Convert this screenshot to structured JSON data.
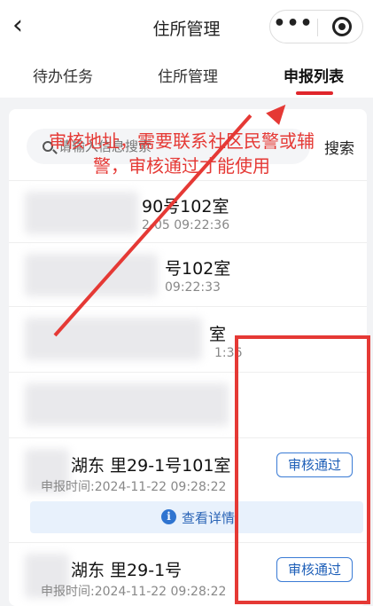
{
  "nav": {
    "back_icon": "‹",
    "title": "住所管理",
    "more_icon": "•••"
  },
  "tabs": [
    {
      "label": "待办任务"
    },
    {
      "label": "住所管理"
    },
    {
      "label": "申报列表"
    }
  ],
  "search": {
    "placeholder": "请输入信息搜索",
    "button_label": "搜索"
  },
  "rows": [
    {
      "address": "90号102室",
      "time": "2-05 09:22:36"
    },
    {
      "address": "号102室",
      "time": "09:22:33"
    },
    {
      "address": "室",
      "time": "1:36"
    },
    {
      "address": "",
      "time": ""
    },
    {
      "address": "湖东 里29-1号101室",
      "time": "申报时间:2024-11-22 09:28:22",
      "status": "审核通过"
    },
    {
      "address": "湖东 里29-1号",
      "time": "申报时间:2024-11-22 09:28:22",
      "status": "审核通过"
    }
  ],
  "detail": {
    "info_icon": "i",
    "label": "查看详情"
  },
  "annotation": {
    "text": "审核地址，需要联系社区民警或辅警，审核通过才能使用"
  },
  "colors": {
    "accent_red": "#e53935",
    "status_blue": "#3a7bd5"
  }
}
